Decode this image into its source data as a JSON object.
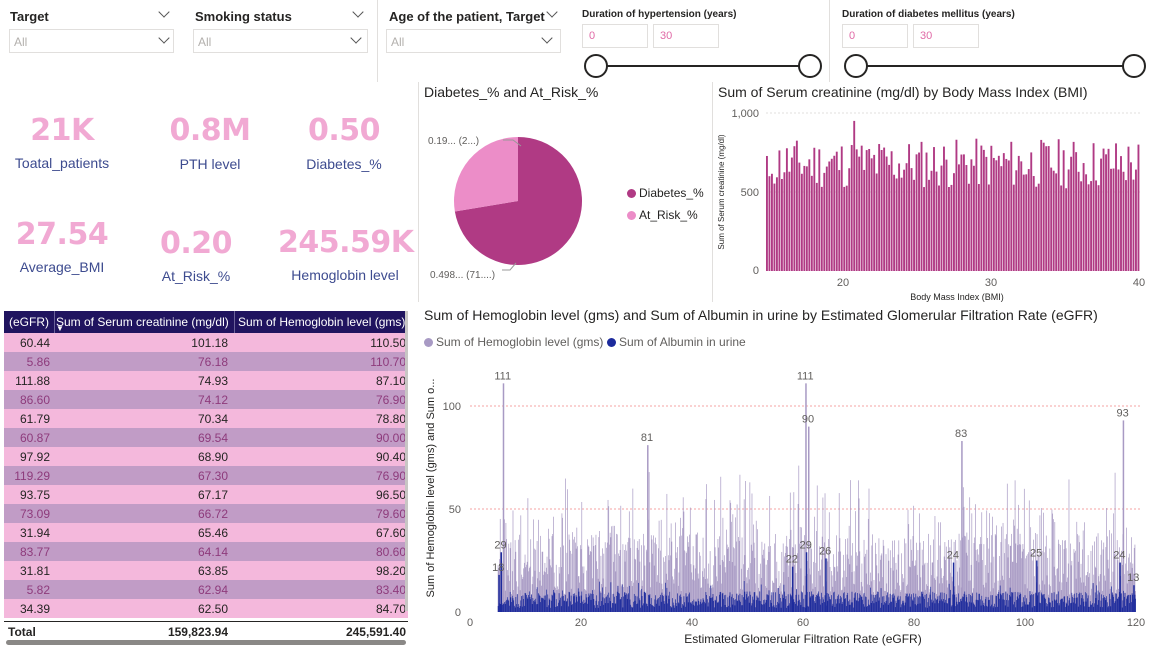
{
  "slicers": [
    {
      "title": "Target",
      "value": "All"
    },
    {
      "title": "Smoking status",
      "value": "All"
    },
    {
      "title": "Age of the patient, Target",
      "value": "All"
    }
  ],
  "range_slicers": [
    {
      "title": "Duration of hypertension (years)",
      "min": "0",
      "max": "30"
    },
    {
      "title": "Duration of diabetes mellitus (years)",
      "min": "0",
      "max": "30"
    }
  ],
  "kpis": [
    {
      "value": "21K",
      "label": "Toatal_patients"
    },
    {
      "value": "0.8M",
      "label": "PTH level"
    },
    {
      "value": "0.50",
      "label": "Diabetes_%"
    },
    {
      "value": "27.54",
      "label": "Average_BMI"
    },
    {
      "value": "0.20",
      "label": "At_Risk_%"
    },
    {
      "value": "245.59K",
      "label": "Hemoglobin level"
    }
  ],
  "pie": {
    "title": "Diabetes_% and At_Risk_%",
    "label_top": "0.19... (2...)",
    "label_bottom": "0.498... (71....)",
    "legend": [
      {
        "name": "Diabetes_%",
        "color": "#b03a84"
      },
      {
        "name": "At_Risk_%",
        "color": "#ec8dc8"
      }
    ]
  },
  "bmi_chart": {
    "title": "Sum of Serum creatinine (mg/dl) by Body Mass Index (BMI)",
    "ylabel": "Sum of Serum creatinine (mg/dl)",
    "xlabel": "Body Mass Index (BMI)",
    "y_ticks": [
      "1,000",
      "500",
      "0"
    ],
    "x_ticks": [
      "20",
      "30",
      "40"
    ],
    "color": "#b03a84"
  },
  "table": {
    "headers": [
      "(eGFR)",
      "Sum of Serum creatinine (mg/dl)",
      "Sum of Hemoglobin level (gms)"
    ],
    "rows": [
      [
        "60.44",
        "101.18",
        "110.50"
      ],
      [
        "5.86",
        "76.18",
        "110.70"
      ],
      [
        "111.88",
        "74.93",
        "87.10"
      ],
      [
        "86.60",
        "74.12",
        "76.90"
      ],
      [
        "61.79",
        "70.34",
        "78.80"
      ],
      [
        "60.87",
        "69.54",
        "90.00"
      ],
      [
        "97.92",
        "68.90",
        "90.40"
      ],
      [
        "119.29",
        "67.30",
        "76.90"
      ],
      [
        "93.75",
        "67.17",
        "96.50"
      ],
      [
        "73.09",
        "66.72",
        "79.60"
      ],
      [
        "31.94",
        "65.46",
        "67.60"
      ],
      [
        "83.77",
        "64.14",
        "80.60"
      ],
      [
        "31.81",
        "63.85",
        "98.20"
      ],
      [
        "5.82",
        "62.94",
        "83.40"
      ],
      [
        "34.39",
        "62.50",
        "84.70"
      ]
    ],
    "total_label": "Total",
    "totals": [
      "159,823.94",
      "245,591.40"
    ]
  },
  "egfr_chart": {
    "title": "Sum of Hemoglobin level (gms) and Sum of Albumin in urine by Estimated Glomerular Filtration Rate (eGFR)",
    "ylabel": "Sum of Hemoglobin level (gms) and Sum o...",
    "xlabel": "Estimated Glomerular Filtration Rate (eGFR)",
    "legend": [
      {
        "name": "Sum of Hemoglobin level (gms)",
        "color": "#a89ac4"
      },
      {
        "name": "Sum of Albumin in urine",
        "color": "#1c2a9c"
      }
    ],
    "y_ticks": [
      "100",
      "50",
      "0"
    ],
    "x_ticks": [
      "0",
      "20",
      "40",
      "60",
      "80",
      "100",
      "120"
    ],
    "data_labels": [
      "111",
      "81",
      "111",
      "90",
      "83",
      "93",
      "29",
      "18",
      "22",
      "29",
      "26",
      "24",
      "25",
      "24",
      "13"
    ]
  },
  "chart_data": [
    {
      "type": "pie",
      "title": "Diabetes_% and At_Risk_%",
      "labels": [
        "Diabetes_%",
        "At_Risk_%"
      ],
      "values": [
        0.498,
        0.19
      ]
    },
    {
      "type": "bar",
      "title": "Sum of Serum creatinine (mg/dl) by Body Mass Index (BMI)",
      "xlabel": "Body Mass Index (BMI)",
      "ylabel": "Sum of Serum creatinine (mg/dl)",
      "xlim": [
        15,
        40
      ],
      "ylim": [
        0,
        1000
      ],
      "approx_range": [
        520,
        950
      ]
    },
    {
      "type": "bar",
      "title": "Sum of Hemoglobin level (gms) and Sum of Albumin in urine by Estimated Glomerular Filtration Rate (eGFR)",
      "xlabel": "Estimated Glomerular Filtration Rate (eGFR)",
      "ylabel": "Sum of Hemoglobin level (gms) and Sum o...",
      "xlim": [
        0,
        120
      ],
      "ylim": [
        0,
        115
      ],
      "series": [
        {
          "name": "Sum of Hemoglobin level (gms)",
          "peaks": [
            [
              5.9,
              111
            ],
            [
              31.9,
              81
            ],
            [
              60.4,
              111
            ],
            [
              60.9,
              90
            ],
            [
              88.5,
              83
            ],
            [
              117.6,
              93
            ]
          ]
        },
        {
          "name": "Sum of Albumin in urine",
          "peaks": [
            [
              5.5,
              29
            ],
            [
              5.1,
              18
            ],
            [
              58,
              22
            ],
            [
              60.5,
              29
            ],
            [
              64,
              26
            ],
            [
              87,
              24
            ],
            [
              102,
              25
            ],
            [
              117,
              24
            ],
            [
              119.5,
              13
            ]
          ]
        }
      ]
    }
  ]
}
